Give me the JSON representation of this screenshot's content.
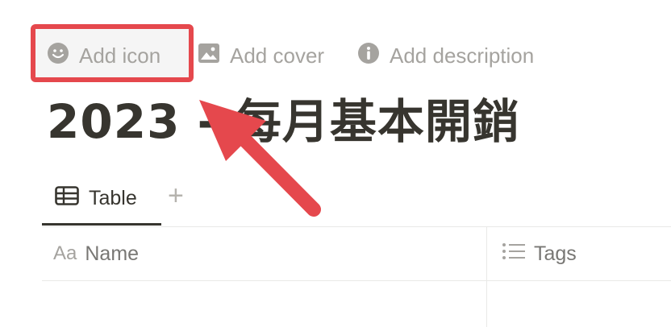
{
  "page_actions": {
    "add_icon": "Add icon",
    "add_cover": "Add cover",
    "add_description": "Add description"
  },
  "page": {
    "title": "2023 - 每月基本開銷"
  },
  "view_tabs": {
    "active_tab": "Table",
    "add_view_symbol": "+"
  },
  "table": {
    "columns": [
      {
        "icon": "aa-text-icon",
        "icon_text": "Aa",
        "label": "Name"
      },
      {
        "icon": "list-icon",
        "label": "Tags"
      }
    ]
  },
  "annotation": {
    "color": "#e5484d"
  }
}
